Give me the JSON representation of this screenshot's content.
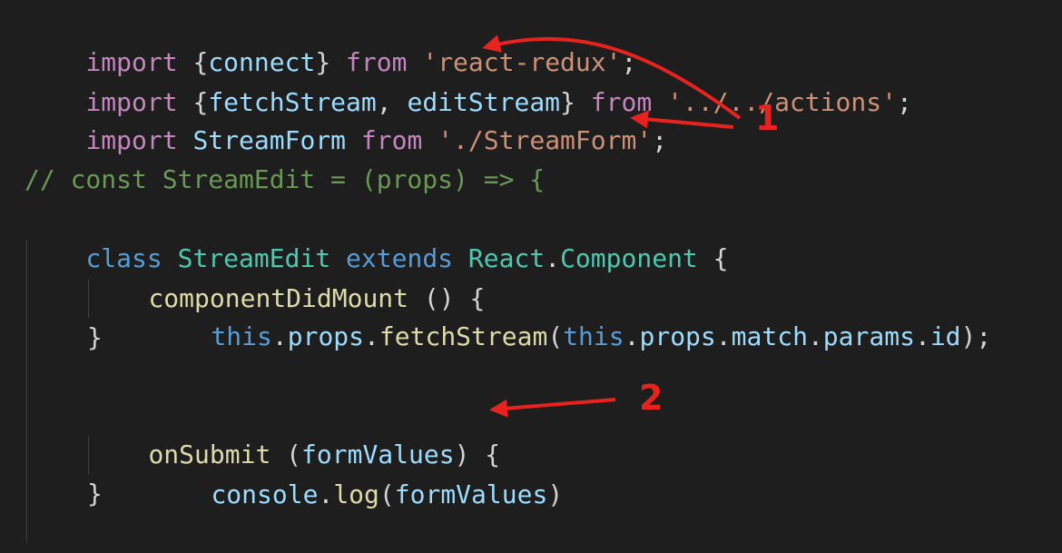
{
  "code": {
    "line1": [
      "import",
      " {",
      "connect",
      "} ",
      "from",
      " ",
      "'react-redux'",
      ";"
    ],
    "line2": [
      "import",
      " {",
      "fetchStream",
      ", ",
      "editStream",
      "} ",
      "from",
      " ",
      "'../../actions'",
      ";"
    ],
    "line3": [
      "import",
      " ",
      "StreamForm",
      " ",
      "from",
      " ",
      "'./StreamForm'",
      ";"
    ],
    "line5": "// const StreamEdit = (props) => {",
    "line6": [
      "class",
      " ",
      "StreamEdit",
      " ",
      "extends",
      " ",
      "React",
      ".",
      "Component",
      " {"
    ],
    "line7": [
      "componentDidMount",
      " () {"
    ],
    "line8": [
      "this",
      ".",
      "props",
      ".",
      "fetchStream",
      "(",
      "this",
      ".",
      "props",
      ".",
      "match",
      ".",
      "params",
      ".",
      "id",
      ");"
    ],
    "line9": "}",
    "line11": [
      "onSubmit",
      " (",
      "formValues",
      ") {"
    ],
    "line12": [
      "console",
      ".",
      "log",
      "(",
      "formValues",
      ")"
    ],
    "line13": "}"
  },
  "annotations": {
    "callout1": "1",
    "callout2": "2",
    "arrow_color": "#e8231f"
  }
}
